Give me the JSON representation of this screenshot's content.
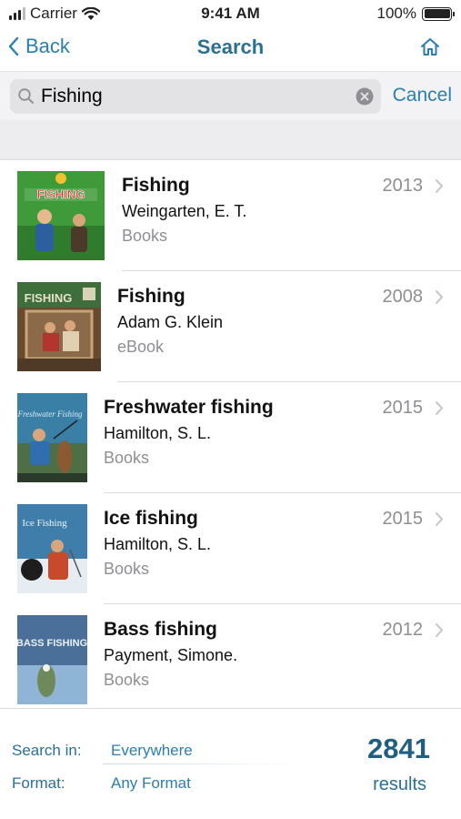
{
  "status_bar": {
    "carrier": "Carrier",
    "time": "9:41 AM",
    "battery": "100%"
  },
  "nav": {
    "back_label": "Back",
    "title": "Search"
  },
  "search": {
    "value": "Fishing",
    "cancel_label": "Cancel"
  },
  "results": [
    {
      "title": "Fishing",
      "author": "Weingarten, E. T.",
      "format": "Books",
      "year": "2013",
      "cover_text": "FISHING",
      "cover_colors": [
        "#3f9a3a",
        "#d92b2b"
      ]
    },
    {
      "title": "Fishing",
      "author": "Adam G. Klein",
      "format": "eBook",
      "year": "2008",
      "cover_text": "FISHING",
      "cover_colors": [
        "#6a4a2c",
        "#3d6e3b"
      ]
    },
    {
      "title": "Freshwater fishing",
      "author": "Hamilton, S. L.",
      "format": "Books",
      "year": "2015",
      "cover_text": "Freshwater Fishing",
      "cover_colors": [
        "#3a7fa6",
        "#8c5a30"
      ]
    },
    {
      "title": "Ice fishing",
      "author": "Hamilton, S. L.",
      "format": "Books",
      "year": "2015",
      "cover_text": "Ice Fishing",
      "cover_colors": [
        "#3f7eaa",
        "#c84a2a"
      ]
    },
    {
      "title": "Bass fishing",
      "author": "Payment, Simone.",
      "format": "Books",
      "year": "2012",
      "cover_text": "BASS FISHING",
      "cover_colors": [
        "#4a6f98",
        "#8fb4d6"
      ]
    }
  ],
  "footer": {
    "search_in_label": "Search in:",
    "search_in_value": "Everywhere",
    "format_label": "Format:",
    "format_value": "Any Format",
    "count": "2841",
    "count_label": "results"
  },
  "colors": {
    "accent": "#2a7fae",
    "title_blue": "#2a6f96",
    "count_blue": "#1f5f84",
    "secondary_text": "#8e8e93"
  },
  "icons": [
    "signal-icon",
    "wifi-icon",
    "battery-icon",
    "back-chevron-icon",
    "home-icon",
    "search-icon",
    "clear-icon",
    "chevron-right-icon"
  ]
}
